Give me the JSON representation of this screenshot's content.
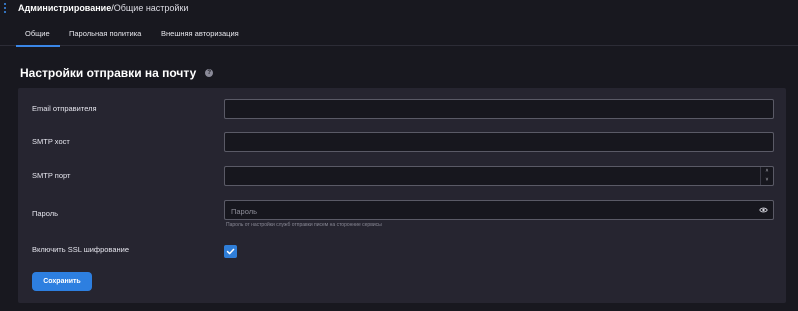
{
  "header": {
    "breadcrumb_section": "Администрирование",
    "breadcrumb_separator": "/",
    "breadcrumb_page": "Общие настройки"
  },
  "tabs": [
    {
      "label": "Общие",
      "active": true
    },
    {
      "label": "Парольная политика",
      "active": false
    },
    {
      "label": "Внешняя авторизация",
      "active": false
    }
  ],
  "section": {
    "title": "Настройки отправки на почту",
    "help_icon": "help-icon"
  },
  "form": {
    "sender_email": {
      "label": "Email отправителя",
      "value": ""
    },
    "smtp_host": {
      "label": "SMTP хост",
      "value": ""
    },
    "smtp_port": {
      "label": "SMTP порт",
      "value": "",
      "stepper_up": "˄",
      "stepper_down": "˅"
    },
    "password": {
      "label": "Пароль",
      "placeholder": "Пароль",
      "value": "",
      "hint": "Пароль от настройки служб отправки писем на сторонние сервисы",
      "toggle_icon": "eye-icon"
    },
    "ssl": {
      "label": "Включить SSL шифрование",
      "checked": true
    },
    "save_label": "Сохранить"
  },
  "colors": {
    "accent": "#2d7fe0",
    "background": "#18181f",
    "card": "#262530"
  }
}
